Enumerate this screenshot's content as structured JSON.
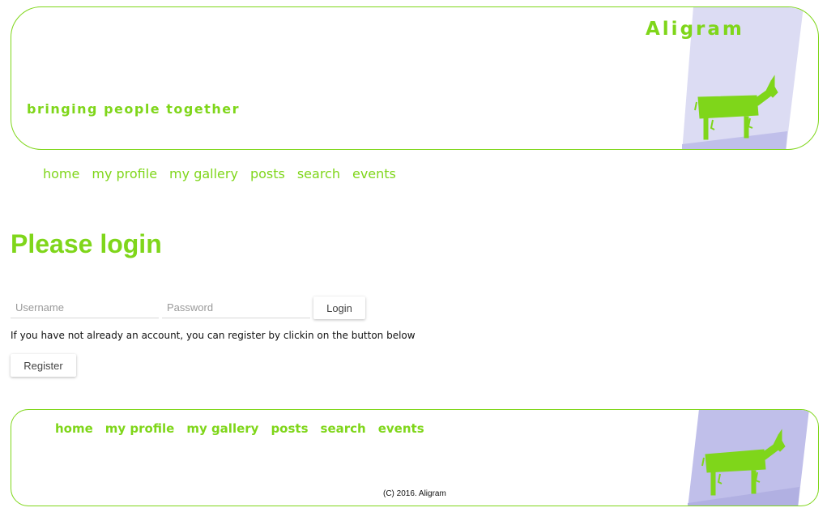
{
  "header": {
    "brand": "Aligram",
    "tagline": "bringing people together"
  },
  "nav": {
    "items": [
      "home",
      "my profile",
      "my gallery",
      "posts",
      "search",
      "events"
    ]
  },
  "main": {
    "title": "Please login",
    "username_placeholder": "Username",
    "password_placeholder": "Password",
    "login_label": "Login",
    "register_hint": "If you have not already an account, you can register by clickin on the button below",
    "register_label": "Register"
  },
  "footer": {
    "nav_items": [
      "home",
      "my profile",
      "my gallery",
      "posts",
      "search",
      "events"
    ],
    "copyright": "(C) 2016. Aligram"
  },
  "colors": {
    "accent": "#7fd61a",
    "panel": "#dcdcf3",
    "panel_dark": "#c0bfea"
  },
  "icons": {
    "logo": "green-donkey-icon"
  }
}
